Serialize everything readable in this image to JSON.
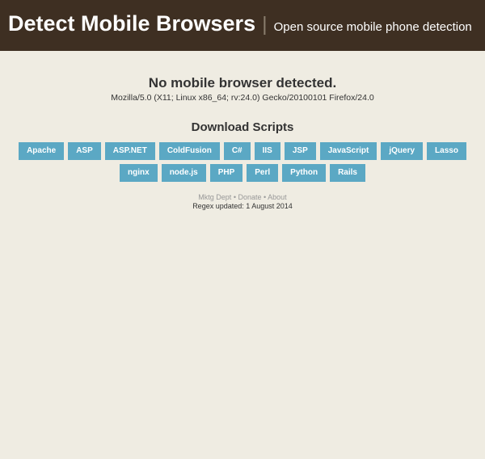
{
  "header": {
    "title": "Detect Mobile Browsers",
    "subtitle": "Open source mobile phone detection"
  },
  "detection": {
    "status": "No mobile browser detected.",
    "user_agent": "Mozilla/5.0 (X11; Linux x86_64; rv:24.0) Gecko/20100101 Firefox/24.0"
  },
  "downloads": {
    "heading": "Download Scripts",
    "items": [
      "Apache",
      "ASP",
      "ASP.NET",
      "ColdFusion",
      "C#",
      "IIS",
      "JSP",
      "JavaScript",
      "jQuery",
      "Lasso",
      "nginx",
      "node.js",
      "PHP",
      "Perl",
      "Python",
      "Rails"
    ]
  },
  "footer": {
    "links": [
      "Mktg Dept",
      "Donate",
      "About"
    ],
    "separator": " • ",
    "updated_label": "Regex updated: ",
    "updated_date": "1 August 2014"
  }
}
